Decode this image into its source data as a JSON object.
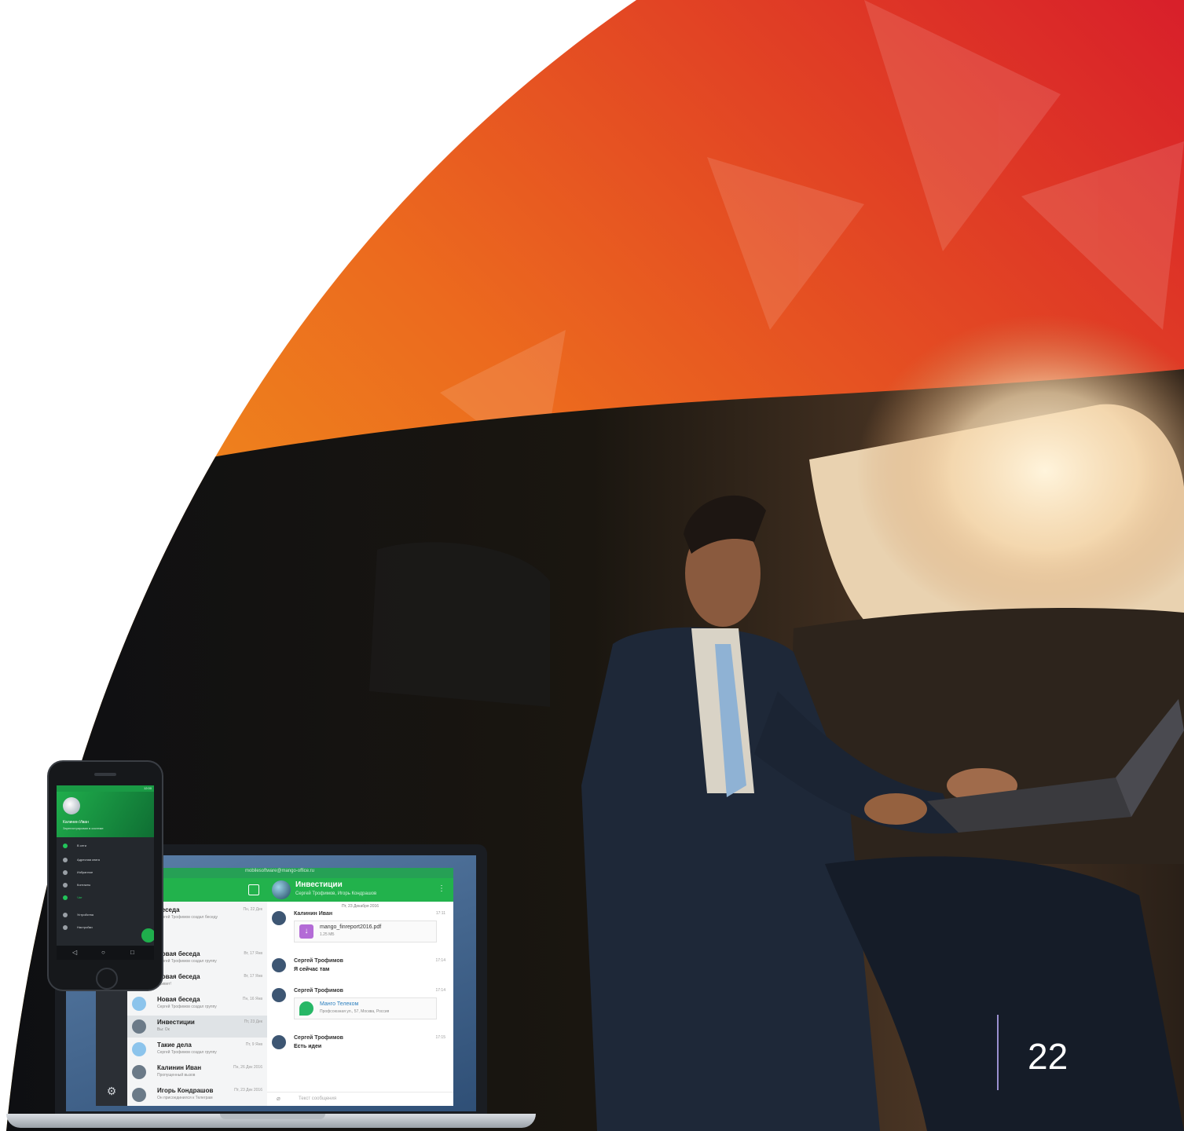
{
  "slide": {
    "page_number": "22",
    "photo_description_icon": "businessman-in-car-photo"
  },
  "colors": {
    "arc_top": "#d81f2a",
    "arc_mid": "#ec6a1e",
    "arc_bottom": "#f2b51a",
    "app_green": "#22b24c",
    "divider": "#9a8fd0"
  },
  "laptop_app": {
    "window_title": "mobilesoftware@mango-office.ru",
    "list_header": "Чат",
    "conversations": [
      {
        "title": "Беседа",
        "sub": "Сергей Трофимов создал беседу",
        "time": "Пн, 22 Дек"
      },
      {
        "title": "Новая беседа",
        "sub": "Сергей Трофимов создал группу",
        "time": "Вт, 17 Янв"
      },
      {
        "title": "Новая беседа",
        "sub": "Привет!",
        "time": "Вт, 17 Янв"
      },
      {
        "title": "Новая беседа",
        "sub": "Сергей Трофимов создал группу",
        "time": "Пн, 16 Янв"
      },
      {
        "title": "Инвестиции",
        "sub": "Вы: Ок",
        "time": "Пт, 23 Дек"
      },
      {
        "title": "Такие дела",
        "sub": "Сергей Трофимов создал группу",
        "time": "Пт, 9 Янв"
      },
      {
        "title": "Калинин Иван",
        "sub": "Пропущенный вызов",
        "time": "Пн, 26 Дек 2016"
      },
      {
        "title": "Игорь Кондрашов",
        "sub": "Он присоединился к Телеграм",
        "time": "Пт, 23 Дек 2016"
      }
    ],
    "chat": {
      "title": "Инвестиции",
      "subtitle": "Сергей Трофимов, Игорь Кондрашов",
      "date": "Пт, 23 Декабря 2016",
      "messages": [
        {
          "name": "Калинин Иван",
          "time": "17:11",
          "attachment_title": "mango_finreport2016.pdf",
          "attachment_sub": "1.25 МБ"
        },
        {
          "name": "Сергей Трофимов",
          "time": "17:14",
          "text": "Я сейчас там"
        },
        {
          "name": "Сергей Трофимов",
          "time": "17:14",
          "attachment_title": "Манго Телеком",
          "attachment_sub": "Профсоюзная ул., 57, Москва, Россия"
        },
        {
          "name": "Сергей Трофимов",
          "time": "17:15",
          "text": "Есть идеи"
        }
      ],
      "input_placeholder": "Текст сообщения"
    }
  },
  "phone_app": {
    "status_time": "12:00",
    "user_name": "Калинин Иван",
    "user_sub": "Зарегистрирован в системе",
    "drawer_items": [
      {
        "label": "В сети"
      },
      {
        "label": "Адресная книга"
      },
      {
        "label": "Избранное"
      },
      {
        "label": "Контакты"
      },
      {
        "label": "Чат"
      },
      {
        "label": "Устройства"
      },
      {
        "label": "Настройки"
      }
    ],
    "nav": {
      "back": "◁",
      "home": "○",
      "recent": "□"
    }
  }
}
